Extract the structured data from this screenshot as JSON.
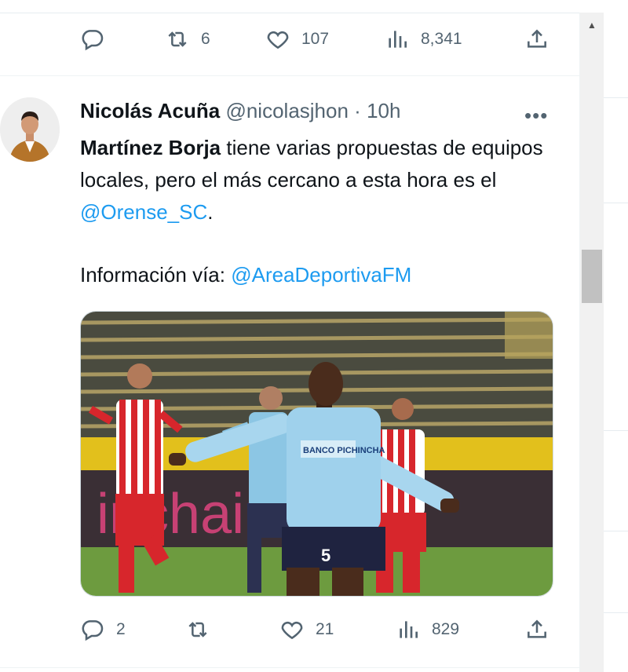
{
  "prev_tweet": {
    "reply_count": "",
    "retweet_count": "6",
    "like_count": "107",
    "views_count": "8,341"
  },
  "tweet": {
    "author_name": "Nicolás Acuña",
    "author_handle": "@nicolasjhon",
    "separator": "·",
    "time_ago": "10h",
    "more_label": "•••",
    "text_bold": "Martínez Borja",
    "text_part1": " tiene varias propuestas de equipos locales, pero el más cercano a esta hora es el ",
    "mention_1": "@Orense_SC",
    "text_part2": ".",
    "info_label": "Información vía: ",
    "mention_2": "@AreaDeportivaFM",
    "sponsor_text": "BANCO PICHINCHA",
    "banner_text": "inchainc",
    "player_number": "5",
    "reply_count": "2",
    "retweet_count": "",
    "like_count": "21",
    "views_count": "829"
  },
  "icons": {
    "reply": "reply-icon",
    "retweet": "retweet-icon",
    "like": "heart-icon",
    "views": "views-icon",
    "share": "share-icon",
    "more": "more-icon"
  },
  "colors": {
    "link": "#1d9bf0",
    "muted": "#536471",
    "text": "#0f1419"
  }
}
